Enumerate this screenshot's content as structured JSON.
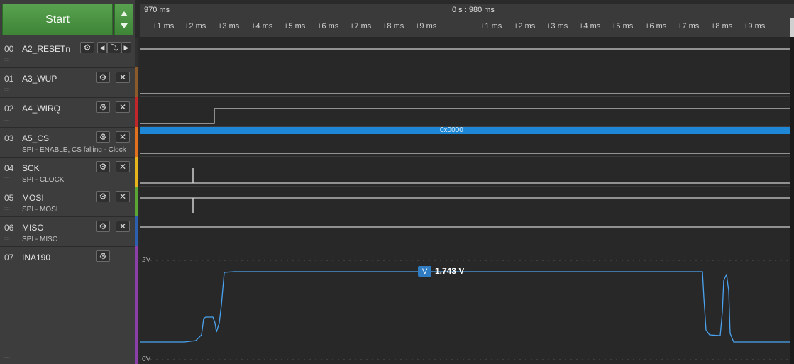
{
  "start_button": "Start",
  "header": {
    "left_time": "970 ms",
    "center_time": "0 s : 980 ms",
    "ticks_left": [
      "+1 ms",
      "+2 ms",
      "+3 ms",
      "+4 ms",
      "+5 ms",
      "+6 ms",
      "+7 ms",
      "+8 ms",
      "+9 ms"
    ],
    "ticks_right": [
      "+1 ms",
      "+2 ms",
      "+3 ms",
      "+4 ms",
      "+5 ms",
      "+6 ms",
      "+7 ms",
      "+8 ms",
      "+9 ms"
    ]
  },
  "channels": [
    {
      "idx": "00",
      "name": "A2_RESETn",
      "sub": "",
      "color": "#303030"
    },
    {
      "idx": "01",
      "name": "A3_WUP",
      "sub": "",
      "color": "#8a5a2b"
    },
    {
      "idx": "02",
      "name": "A4_WIRQ",
      "sub": "",
      "color": "#c0262a"
    },
    {
      "idx": "03",
      "name": "A5_CS",
      "sub": "SPI - ENABLE, CS falling - Clock",
      "color": "#e0701e"
    },
    {
      "idx": "04",
      "name": "SCK",
      "sub": "SPI - CLOCK",
      "color": "#e6b51e"
    },
    {
      "idx": "05",
      "name": "MOSI",
      "sub": "SPI - MOSI",
      "color": "#5aa533"
    },
    {
      "idx": "06",
      "name": "MISO",
      "sub": "SPI - MISO",
      "color": "#2d5fae"
    },
    {
      "idx": "07",
      "name": "INA190",
      "sub": "",
      "color": "#8b3fa8"
    }
  ],
  "bus_value": "0x0000",
  "analog": {
    "top_label": "2V",
    "bottom_label": "0V",
    "marker_icon": "V",
    "marker_value": "1.743 V"
  },
  "icons": {
    "gear": "gear-icon",
    "close": "close-icon",
    "prev": "prev-edge-icon",
    "edge": "falling-edge-icon",
    "next": "next-edge-icon"
  }
}
